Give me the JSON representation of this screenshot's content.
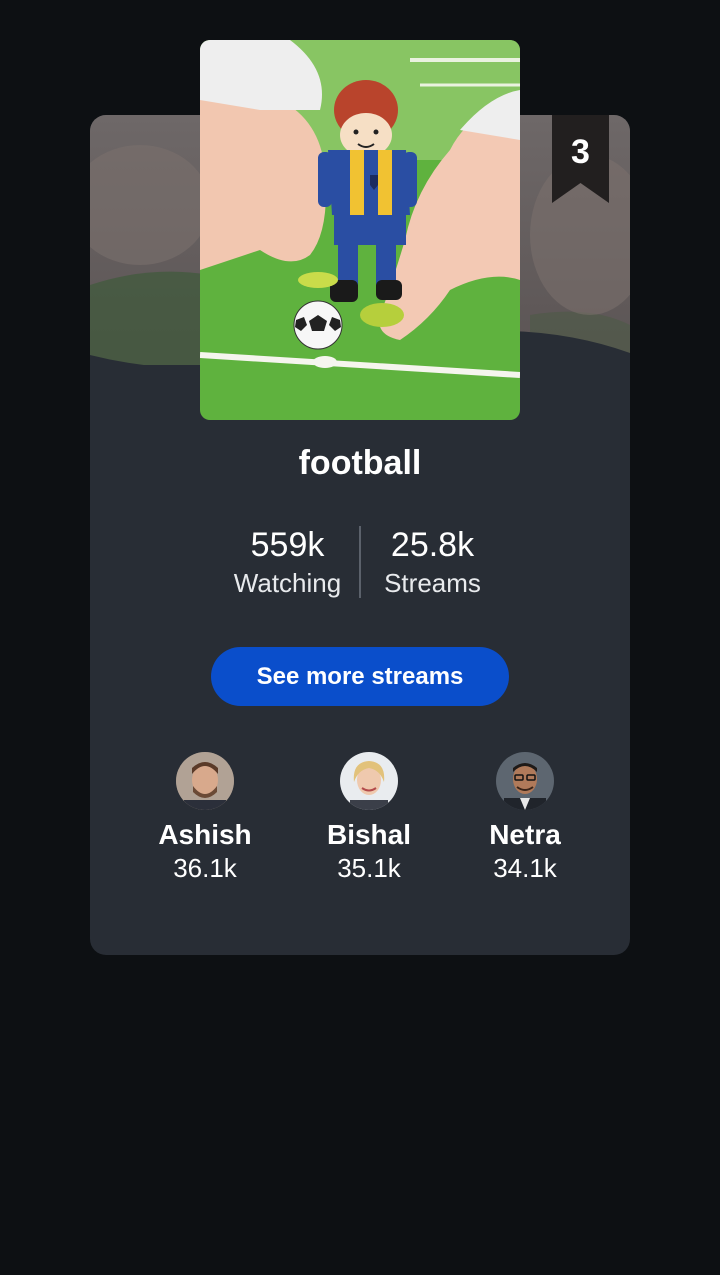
{
  "rank": "3",
  "category": {
    "title": "football",
    "image_icon": "football-toy-image"
  },
  "stats": {
    "watching_value": "559k",
    "watching_label": "Watching",
    "streams_value": "25.8k",
    "streams_label": "Streams"
  },
  "cta_label": "See more streams",
  "streamers": [
    {
      "name": "Ashish",
      "count": "36.1k"
    },
    {
      "name": "Bishal",
      "count": "35.1k"
    },
    {
      "name": "Netra",
      "count": "34.1k"
    }
  ],
  "colors": {
    "background": "#0d1013",
    "card": "#282d35",
    "accent_button": "#0a4ecb",
    "ribbon": "#221f1f"
  }
}
